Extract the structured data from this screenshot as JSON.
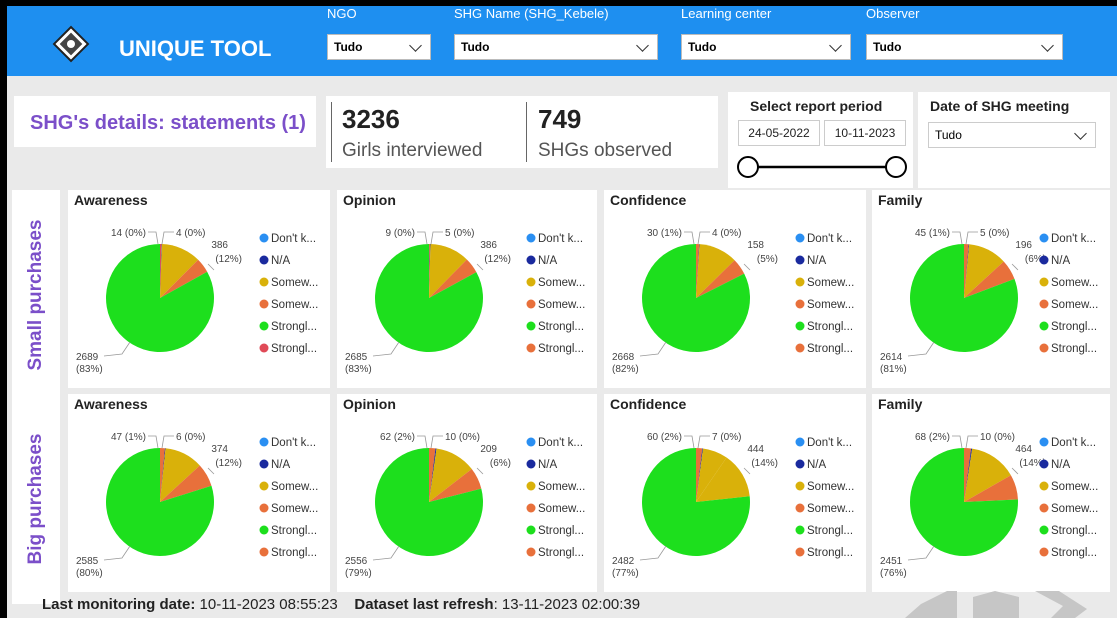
{
  "app": {
    "title": "UNIQUE TOOL",
    "logo_icon": "organization-seal-icon"
  },
  "filters": [
    {
      "label": "NGO",
      "value": "Tudo"
    },
    {
      "label": "SHG Name (SHG_Kebele)",
      "value": "Tudo"
    },
    {
      "label": "Learning center",
      "value": "Tudo"
    },
    {
      "label": "Observer",
      "value": "Tudo"
    }
  ],
  "statement": {
    "title": "SHG's details: statements (1)"
  },
  "kpis": [
    {
      "value": "3236",
      "label": "Girls interviewed"
    },
    {
      "value": "749",
      "label": "SHGs observed"
    }
  ],
  "report_period": {
    "title": "Select report period",
    "start": "24-05-2022",
    "end": "10-11-2023"
  },
  "meeting_date": {
    "title": "Date of SHG meeting",
    "value": "Tudo"
  },
  "rows": [
    {
      "label": "Small purchases"
    },
    {
      "label": "Big purchases"
    }
  ],
  "colors": {
    "dont_know": "#2a8ff2",
    "na": "#1a2a9e",
    "somewhat_agree": "#d9b10a",
    "somewhat_disagree": "#e8703b",
    "strongly_agree": "#1ddf1d",
    "strongly_disagree_red": "#e04a57",
    "strongly_disagree_orange": "#e8703b",
    "topbar": "#1e8ff0",
    "accent_purple": "#7b4fc9"
  },
  "chart_data": [
    {
      "type": "pie",
      "row": "Small purchases",
      "title": "Awareness",
      "legend": [
        {
          "label": "Don't k...",
          "color": "#2a8ff2"
        },
        {
          "label": "N/A",
          "color": "#1a2a9e"
        },
        {
          "label": "Somew...",
          "color": "#d9b10a"
        },
        {
          "label": "Somew...",
          "color": "#e8703b"
        },
        {
          "label": "Strongl...",
          "color": "#1ddf1d"
        },
        {
          "label": "Strongl...",
          "color": "#e04a57"
        }
      ],
      "slices": [
        {
          "value": 2689,
          "pct": "83%",
          "color": "#1ddf1d"
        },
        {
          "value": 14,
          "pct": "0%",
          "color": "#e04a57"
        },
        {
          "value": 4,
          "pct": "0%",
          "color": "#1a2a9e"
        },
        {
          "value": 386,
          "pct": "12%",
          "color": "#d9b10a"
        },
        {
          "value": 143,
          "pct": "",
          "color": "#e8703b"
        }
      ],
      "labels": [
        {
          "text": "2689",
          "pct": "(83%)"
        },
        {
          "text": "14 (0%)",
          "pct": ""
        },
        {
          "text": "4 (0%)",
          "pct": ""
        },
        {
          "text": "386",
          "pct": "(12%)"
        }
      ]
    },
    {
      "type": "pie",
      "row": "Small purchases",
      "title": "Opinion",
      "legend": [
        {
          "label": "Don't k...",
          "color": "#2a8ff2"
        },
        {
          "label": "N/A",
          "color": "#1a2a9e"
        },
        {
          "label": "Somew...",
          "color": "#d9b10a"
        },
        {
          "label": "Somew...",
          "color": "#e8703b"
        },
        {
          "label": "Strongl...",
          "color": "#1ddf1d"
        },
        {
          "label": "Strongl...",
          "color": "#e8703b"
        }
      ],
      "slices": [
        {
          "value": 2685,
          "pct": "83%",
          "color": "#1ddf1d"
        },
        {
          "value": 9,
          "pct": "0%",
          "color": "#e8703b"
        },
        {
          "value": 5,
          "pct": "0%",
          "color": "#1a2a9e"
        },
        {
          "value": 386,
          "pct": "12%",
          "color": "#d9b10a"
        },
        {
          "value": 151,
          "pct": "",
          "color": "#e8703b"
        }
      ],
      "labels": [
        {
          "text": "2685",
          "pct": "(83%)"
        },
        {
          "text": "9 (0%)",
          "pct": ""
        },
        {
          "text": "5 (0%)",
          "pct": ""
        },
        {
          "text": "386",
          "pct": "(12%)"
        }
      ]
    },
    {
      "type": "pie",
      "row": "Small purchases",
      "title": "Confidence",
      "legend": [
        {
          "label": "Don't k...",
          "color": "#2a8ff2"
        },
        {
          "label": "N/A",
          "color": "#1a2a9e"
        },
        {
          "label": "Somew...",
          "color": "#d9b10a"
        },
        {
          "label": "Somew...",
          "color": "#e8703b"
        },
        {
          "label": "Strongl...",
          "color": "#1ddf1d"
        },
        {
          "label": "Strongl...",
          "color": "#e8703b"
        }
      ],
      "slices": [
        {
          "value": 2668,
          "pct": "82%",
          "color": "#1ddf1d"
        },
        {
          "value": 30,
          "pct": "1%",
          "color": "#e8703b"
        },
        {
          "value": 4,
          "pct": "0%",
          "color": "#1a2a9e"
        },
        {
          "value": 376,
          "pct": "",
          "color": "#d9b10a"
        },
        {
          "value": 158,
          "pct": "5%",
          "color": "#e8703b"
        }
      ],
      "labels": [
        {
          "text": "2668",
          "pct": "(82%)"
        },
        {
          "text": "30 (1%)",
          "pct": ""
        },
        {
          "text": "4 (0%)",
          "pct": ""
        },
        {
          "text": "158",
          "pct": "(5%)"
        }
      ]
    },
    {
      "type": "pie",
      "row": "Small purchases",
      "title": "Family",
      "legend": [
        {
          "label": "Don't k...",
          "color": "#2a8ff2"
        },
        {
          "label": "N/A",
          "color": "#1a2a9e"
        },
        {
          "label": "Somew...",
          "color": "#d9b10a"
        },
        {
          "label": "Somew...",
          "color": "#e8703b"
        },
        {
          "label": "Strongl...",
          "color": "#1ddf1d"
        },
        {
          "label": "Strongl...",
          "color": "#e8703b"
        }
      ],
      "slices": [
        {
          "value": 2614,
          "pct": "81%",
          "color": "#1ddf1d"
        },
        {
          "value": 45,
          "pct": "1%",
          "color": "#e8703b"
        },
        {
          "value": 5,
          "pct": "0%",
          "color": "#1a2a9e"
        },
        {
          "value": 376,
          "pct": "",
          "color": "#d9b10a"
        },
        {
          "value": 196,
          "pct": "6%",
          "color": "#e8703b"
        }
      ],
      "labels": [
        {
          "text": "2614",
          "pct": "(81%)"
        },
        {
          "text": "45 (1%)",
          "pct": ""
        },
        {
          "text": "5 (0%)",
          "pct": ""
        },
        {
          "text": "196",
          "pct": "(6%)"
        }
      ]
    },
    {
      "type": "pie",
      "row": "Big purchases",
      "title": "Awareness",
      "legend": [
        {
          "label": "Don't k...",
          "color": "#2a8ff2"
        },
        {
          "label": "N/A",
          "color": "#1a2a9e"
        },
        {
          "label": "Somew...",
          "color": "#d9b10a"
        },
        {
          "label": "Somew...",
          "color": "#e8703b"
        },
        {
          "label": "Strongl...",
          "color": "#1ddf1d"
        },
        {
          "label": "Strongl...",
          "color": "#e8703b"
        }
      ],
      "slices": [
        {
          "value": 2585,
          "pct": "80%",
          "color": "#1ddf1d"
        },
        {
          "value": 47,
          "pct": "1%",
          "color": "#e8703b"
        },
        {
          "value": 6,
          "pct": "0%",
          "color": "#1a2a9e"
        },
        {
          "value": 374,
          "pct": "12%",
          "color": "#d9b10a"
        },
        {
          "value": 224,
          "pct": "",
          "color": "#e8703b"
        }
      ],
      "labels": [
        {
          "text": "2585",
          "pct": "(80%)"
        },
        {
          "text": "47 (1%)",
          "pct": ""
        },
        {
          "text": "6 (0%)",
          "pct": ""
        },
        {
          "text": "374",
          "pct": "(12%)"
        }
      ]
    },
    {
      "type": "pie",
      "row": "Big purchases",
      "title": "Opinion",
      "legend": [
        {
          "label": "Don't k...",
          "color": "#2a8ff2"
        },
        {
          "label": "N/A",
          "color": "#1a2a9e"
        },
        {
          "label": "Somew...",
          "color": "#d9b10a"
        },
        {
          "label": "Somew...",
          "color": "#e8703b"
        },
        {
          "label": "Strongl...",
          "color": "#1ddf1d"
        },
        {
          "label": "Strongl...",
          "color": "#e8703b"
        }
      ],
      "slices": [
        {
          "value": 2556,
          "pct": "79%",
          "color": "#1ddf1d"
        },
        {
          "value": 62,
          "pct": "2%",
          "color": "#e8703b"
        },
        {
          "value": 10,
          "pct": "0%",
          "color": "#1a2a9e"
        },
        {
          "value": 399,
          "pct": "",
          "color": "#d9b10a"
        },
        {
          "value": 209,
          "pct": "6%",
          "color": "#e8703b"
        }
      ],
      "labels": [
        {
          "text": "2556",
          "pct": "(79%)"
        },
        {
          "text": "62 (2%)",
          "pct": ""
        },
        {
          "text": "10 (0%)",
          "pct": ""
        },
        {
          "text": "209",
          "pct": "(6%)"
        }
      ]
    },
    {
      "type": "pie",
      "row": "Big purchases",
      "title": "Confidence",
      "legend": [
        {
          "label": "Don't k...",
          "color": "#2a8ff2"
        },
        {
          "label": "N/A",
          "color": "#1a2a9e"
        },
        {
          "label": "Somew...",
          "color": "#d9b10a"
        },
        {
          "label": "Somew...",
          "color": "#e8703b"
        },
        {
          "label": "Strongl...",
          "color": "#1ddf1d"
        },
        {
          "label": "Strongl...",
          "color": "#e8703b"
        }
      ],
      "slices": [
        {
          "value": 2482,
          "pct": "77%",
          "color": "#1ddf1d"
        },
        {
          "value": 60,
          "pct": "2%",
          "color": "#e8703b"
        },
        {
          "value": 7,
          "pct": "0%",
          "color": "#1a2a9e"
        },
        {
          "value": 243,
          "pct": "",
          "color": "#d9b10a"
        },
        {
          "value": 444,
          "pct": "14%",
          "color": "#d9b10a"
        }
      ],
      "labels": [
        {
          "text": "2482",
          "pct": "(77%)"
        },
        {
          "text": "60 (2%)",
          "pct": ""
        },
        {
          "text": "7 (0%)",
          "pct": ""
        },
        {
          "text": "444",
          "pct": "(14%)"
        }
      ]
    },
    {
      "type": "pie",
      "row": "Big purchases",
      "title": "Family",
      "legend": [
        {
          "label": "Don't k...",
          "color": "#2a8ff2"
        },
        {
          "label": "N/A",
          "color": "#1a2a9e"
        },
        {
          "label": "Somew...",
          "color": "#d9b10a"
        },
        {
          "label": "Somew...",
          "color": "#e8703b"
        },
        {
          "label": "Strongl...",
          "color": "#1ddf1d"
        },
        {
          "label": "Strongl...",
          "color": "#e8703b"
        }
      ],
      "slices": [
        {
          "value": 2451,
          "pct": "76%",
          "color": "#1ddf1d"
        },
        {
          "value": 68,
          "pct": "2%",
          "color": "#e8703b"
        },
        {
          "value": 10,
          "pct": "0%",
          "color": "#1a2a9e"
        },
        {
          "value": 464,
          "pct": "14%",
          "color": "#d9b10a"
        },
        {
          "value": 243,
          "pct": "",
          "color": "#e8703b"
        }
      ],
      "labels": [
        {
          "text": "2451",
          "pct": "(76%)"
        },
        {
          "text": "68 (2%)",
          "pct": ""
        },
        {
          "text": "10 (0%)",
          "pct": ""
        },
        {
          "text": "464",
          "pct": "(14%)"
        }
      ]
    }
  ],
  "footer": {
    "monitoring_label": "Last monitoring date:",
    "monitoring_value": "10-11-2023 08:55:23",
    "refresh_label": "Dataset last refresh",
    "refresh_value": ": 13-11-2023 02:00:39"
  },
  "nav": {
    "prev_icon": "chevron-left-icon",
    "home_icon": "home-square-icon",
    "next_icon": "chevron-right-icon"
  }
}
